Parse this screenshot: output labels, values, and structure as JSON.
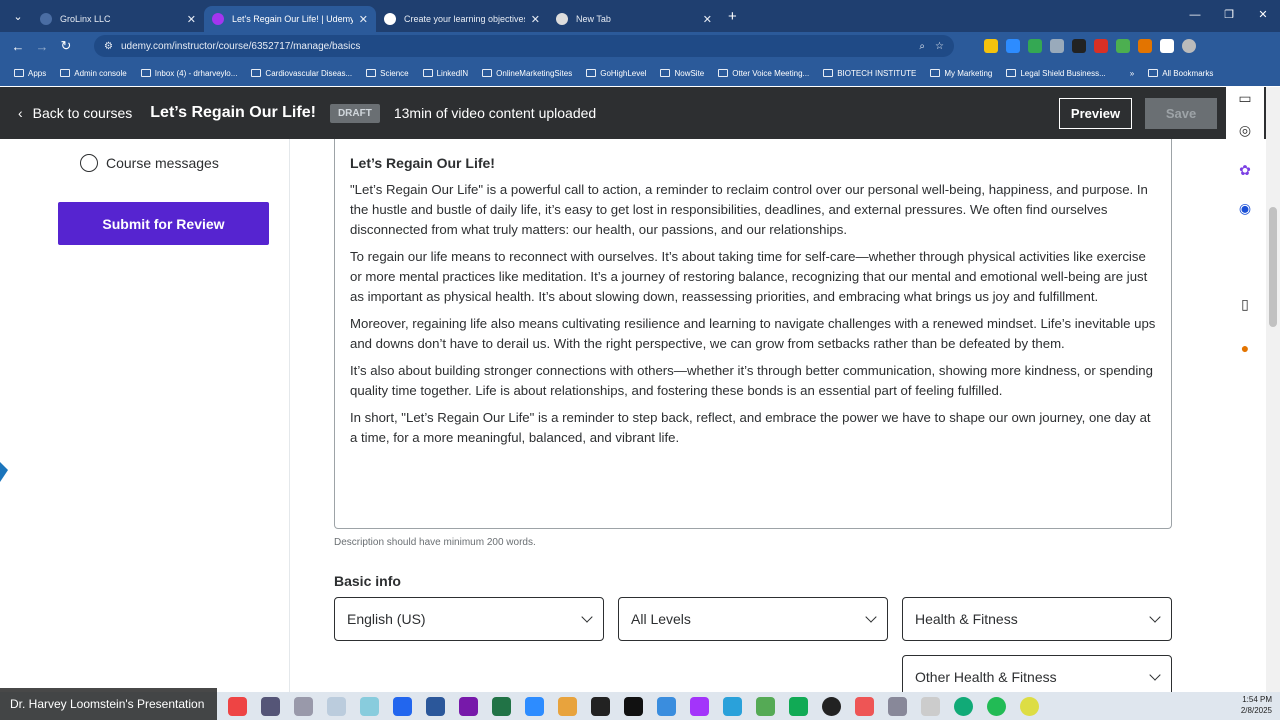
{
  "browser": {
    "tabs": [
      {
        "title": "GroLinx LLC",
        "active": false
      },
      {
        "title": "Let's Regain Our Life! | Udemy",
        "active": true
      },
      {
        "title": "Create your learning objectives",
        "active": false
      },
      {
        "title": "New Tab",
        "active": false
      }
    ],
    "url": "udemy.com/instructor/course/6352717/manage/basics",
    "bookmarks": [
      "Apps",
      "Admin console",
      "Inbox (4) - drharveylo...",
      "Cardiovascular Diseas...",
      "Science",
      "LinkedIN",
      "OnlineMarketingSites",
      "GoHighLevel",
      "NowSite",
      "Otter Voice Meeting...",
      "BIOTECH INSTITUTE",
      "My Marketing",
      "Legal Shield Business..."
    ],
    "all_bookmarks": "All Bookmarks"
  },
  "header": {
    "back_label": "Back to courses",
    "course_title": "Let’s Regain Our Life!",
    "status_badge": "DRAFT",
    "uploaded_text": "13min of video content uploaded",
    "preview_label": "Preview",
    "save_label": "Save"
  },
  "sidebar": {
    "course_messages": "Course messages",
    "submit_label": "Submit for Review"
  },
  "description": {
    "heading": "Let’s Regain Our Life!",
    "paragraphs": [
      " \"Let’s Regain Our Life\" is a powerful call to action, a reminder to reclaim control over our personal well-being, happiness, and purpose. In the hustle and bustle of daily life, it’s easy to get lost in responsibilities, deadlines, and external pressures. We often find ourselves disconnected from what truly matters: our health, our passions, and our relationships.",
      "To regain our life means to reconnect with ourselves. It’s about taking time for self-care—whether through physical activities like exercise or more mental practices like meditation. It’s a journey of restoring balance, recognizing that our mental and emotional well-being are just as important as physical health. It’s about slowing down, reassessing priorities, and embracing what brings us joy and fulfillment.",
      "Moreover, regaining life also means cultivating resilience and learning to navigate challenges with a renewed mindset. Life’s inevitable ups and downs don’t have to derail us. With the right perspective, we can grow from setbacks rather than be defeated by them.",
      "It’s also about building stronger connections with others—whether it’s through better communication, showing more kindness, or spending quality time together. Life is about relationships, and fostering these bonds is an essential part of feeling fulfilled.",
      "In short, \"Let’s Regain Our Life\" is a reminder to step back, reflect, and embrace the power we have to shape our own journey, one day at a time, for a more meaningful, balanced, and vibrant life."
    ],
    "hint": "Description should have minimum 200 words."
  },
  "basic_info": {
    "label": "Basic info",
    "language": "English (US)",
    "level": "All Levels",
    "category": "Health & Fitness",
    "subcategory": "Other Health & Fitness"
  },
  "taskbar": {
    "presenter": "Dr. Harvey Loomstein's Presentation",
    "time": "1:54 PM",
    "date": "2/8/2025"
  }
}
